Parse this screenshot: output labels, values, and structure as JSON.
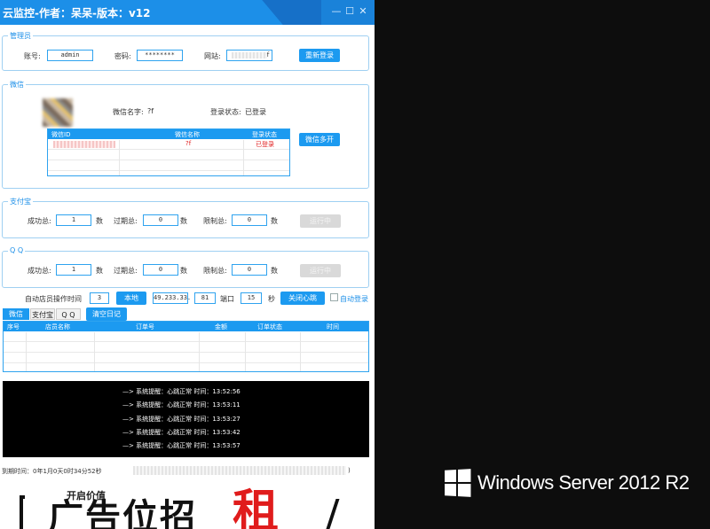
{
  "window": {
    "title": "云监控-作者：呆呆-版本：v12",
    "min_glyph": "—",
    "max_glyph": "☐",
    "close_glyph": "✕"
  },
  "admin": {
    "legend": "管理员",
    "account_label": "账号:",
    "account_value": "admin",
    "password_label": "密码:",
    "password_value": "********",
    "site_label": "网站:",
    "site_value": "f",
    "relogin_button": "重新登录"
  },
  "wechat": {
    "legend": "微信",
    "name_label": "微信名字:",
    "name_value": "?f",
    "status_label": "登录状态:",
    "status_value": "已登录",
    "multi_button": "微信多开",
    "table": {
      "headers": [
        "微信ID",
        "微信名称",
        "登录状态"
      ],
      "rows": [
        {
          "name": "?f",
          "status": "已登录"
        }
      ]
    }
  },
  "alipay": {
    "legend": "支付宝",
    "success_label": "成功总:",
    "success_value": "1",
    "success_unit": "数",
    "expired_label": "过期总:",
    "expired_value": "0",
    "expired_unit": "数",
    "limit_label": "限制总:",
    "limit_value": "0",
    "limit_unit": "数",
    "run_button": "运行中"
  },
  "qq": {
    "legend": "Q Q",
    "success_label": "成功总:",
    "success_value": "1",
    "success_unit": "数",
    "expired_label": "过期总:",
    "expired_value": "0",
    "expired_unit": "数",
    "limit_label": "限制总:",
    "limit_value": "0",
    "limit_unit": "数",
    "run_button": "运行中"
  },
  "control": {
    "auto_label": "自动店员操作时间",
    "auto_value": "3",
    "local_button": "本地",
    "ip_value": "49.233.33.",
    "ip_suffix": "81",
    "port_label": "端口",
    "port_value": "15",
    "sec_label": "秒",
    "heartbeat_button": "关闭心跳",
    "autologin_label": "自动登录"
  },
  "tabs": [
    "微信",
    "支付宝",
    "Q Q"
  ],
  "clear_log_button": "清空日记",
  "orders": {
    "headers": [
      "序号",
      "店员名称",
      "订单号",
      "金额",
      "订单状态",
      "时间"
    ]
  },
  "log": [
    "—> 系统提醒：心跳正常 时间：13:52:56",
    "—> 系统提醒：心跳正常 时间：13:53:11",
    "—> 系统提醒：心跳正常 时间：13:53:27",
    "—> 系统提醒：心跳正常 时间：13:53:42",
    "—> 系统提醒：心跳正常 时间：13:53:57"
  ],
  "expiry": "到期时间：0年1月0天0时34分52秒",
  "expiry_tail": ")",
  "banner": {
    "small": "开启价值",
    "big": "广告位招",
    "red": "租"
  },
  "desktop": {
    "os_label": "Windows Server 2012 R2"
  },
  "colors": {
    "accent": "#1c9af0",
    "titlebar": "#1c8fe8",
    "status_red": "#e02020"
  }
}
